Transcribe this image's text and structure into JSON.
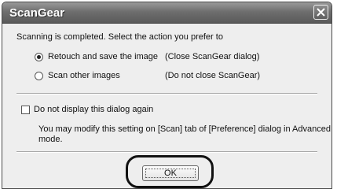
{
  "window": {
    "title": "ScanGear",
    "close_icon": "close-icon"
  },
  "prompt": "Scanning is completed. Select the action you prefer to",
  "options": [
    {
      "label": "Retouch and save the image",
      "note": "(Close ScanGear dialog)",
      "selected": true
    },
    {
      "label": "Scan other images",
      "note": "(Do not close ScanGear)",
      "selected": false
    }
  ],
  "checkbox": {
    "label": "Do not display this dialog again",
    "checked": false
  },
  "info": {
    "line1": "You may modify this setting on [Scan] tab of  [Preference] dialog in Advanced",
    "line2": "mode."
  },
  "ok_label": "OK"
}
